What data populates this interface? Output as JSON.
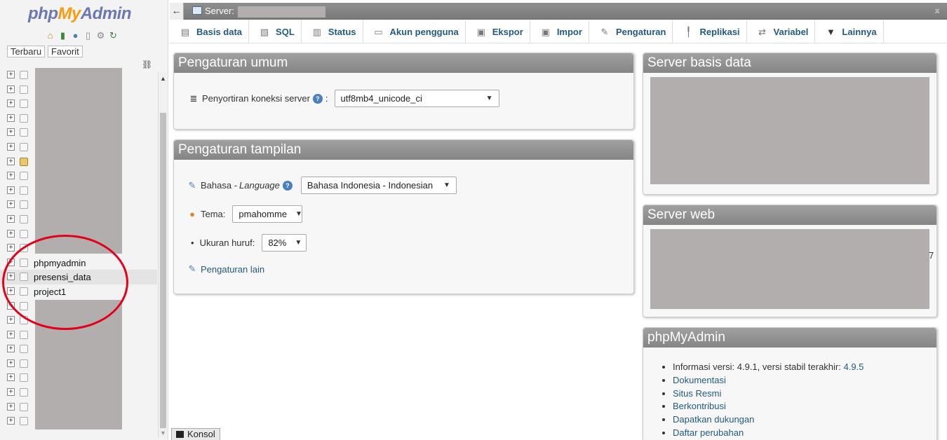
{
  "nav": {
    "logo_php": "php",
    "logo_my": "My",
    "logo_admin": "Admin",
    "tab_recent": "Terbaru",
    "tab_favorites": "Favorit",
    "visible_databases": [
      "phpmyadmin",
      "presensi_data",
      "project1"
    ],
    "selected_database": "presensi_data"
  },
  "topbar": {
    "server_label": "Server:"
  },
  "menu": {
    "items": [
      {
        "label": "Basis data",
        "icon": "database-icon"
      },
      {
        "label": "SQL",
        "icon": "sql-icon"
      },
      {
        "label": "Status",
        "icon": "status-icon"
      },
      {
        "label": "Akun pengguna",
        "icon": "users-icon"
      },
      {
        "label": "Ekspor",
        "icon": "export-icon"
      },
      {
        "label": "Impor",
        "icon": "import-icon"
      },
      {
        "label": "Pengaturan",
        "icon": "wrench-icon"
      },
      {
        "label": "Replikasi",
        "icon": "replication-icon"
      },
      {
        "label": "Variabel",
        "icon": "variables-icon"
      },
      {
        "label": "Lainnya",
        "icon": "chevron-down-icon"
      }
    ]
  },
  "general": {
    "title": "Pengaturan umum",
    "collation_label": "Penyortiran koneksi server",
    "collation_value": "utf8mb4_unicode_ci"
  },
  "display": {
    "title": "Pengaturan tampilan",
    "language_label": "Bahasa - ",
    "language_label_italic": "Language",
    "language_value": "Bahasa Indonesia - Indonesian",
    "theme_label": "Tema:",
    "theme_value": "pmahomme",
    "fontsize_label": "Ukuran huruf:",
    "fontsize_value": "82%",
    "more_settings": "Pengaturan lain"
  },
  "db_server": {
    "title": "Server basis data"
  },
  "web_server": {
    "title": "Server web",
    "stray_text": "7"
  },
  "pma": {
    "title": "phpMyAdmin",
    "version_text": "Informasi versi: 4.9.1, versi stabil terakhir: ",
    "latest_version": "4.9.5",
    "links": [
      "Dokumentasi",
      "Situs Resmi",
      "Berkontribusi",
      "Dapatkan dukungan",
      "Daftar perubahan"
    ]
  },
  "console": {
    "label": "Konsol"
  },
  "colors": {
    "accent_link": "#235a81",
    "panel_header": "#8f8f8f",
    "redaction": "#b3aeae",
    "annotation_circle": "#e4001b"
  }
}
